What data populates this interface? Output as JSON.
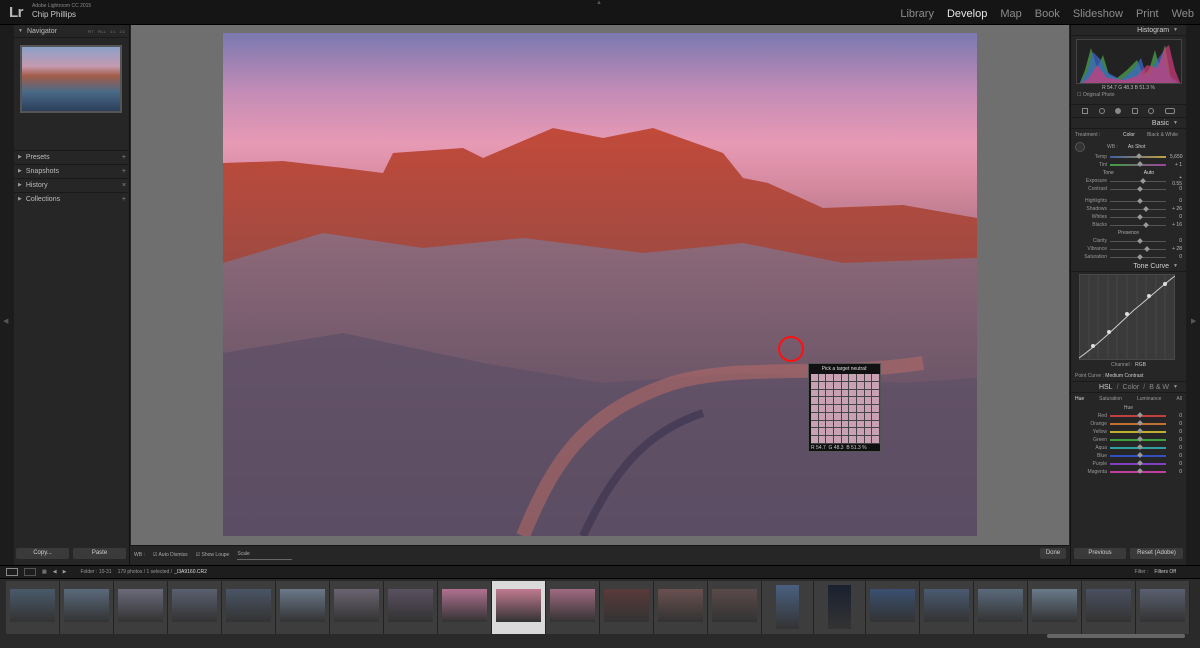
{
  "app": {
    "logo": "Lr",
    "product": "Adobe Lightroom CC 2015",
    "user": "Chip Phillips"
  },
  "modules": [
    "Library",
    "Develop",
    "Map",
    "Book",
    "Slideshow",
    "Print",
    "Web"
  ],
  "active_module": "Develop",
  "left": {
    "navigator": "Navigator",
    "zoom": [
      "FIT",
      "FILL",
      "1:1",
      "2:1"
    ],
    "sections": [
      "Presets",
      "Snapshots",
      "History",
      "Collections"
    ],
    "copy": "Copy...",
    "paste": "Paste"
  },
  "picker": {
    "title": "Pick a target neutral:",
    "r": "R  54.7",
    "g": "G  48.3",
    "b": "B  51.3  %"
  },
  "toolbar": {
    "wb": "WB :",
    "auto_dismiss": "Auto Dismiss",
    "show_loupe": "Show Loupe",
    "scale": "Scale",
    "done": "Done"
  },
  "right": {
    "histogram": "Histogram",
    "histo_vals": "R  54.7   G  48.3   B  51.3  %",
    "original": "Original Photo",
    "basic": "Basic",
    "treatment": "Treatment :",
    "color": "Color",
    "bw": "Black & White",
    "wb": "WB :",
    "wb_val": "As Shot",
    "tone": "Tone",
    "auto": "Auto",
    "presence": "Presence",
    "sliders_wb": [
      {
        "l": "Temp",
        "v": "5,650"
      },
      {
        "l": "Tint",
        "v": "+ 1"
      }
    ],
    "sliders_tone": [
      {
        "l": "Exposure",
        "v": "+ 0.55"
      },
      {
        "l": "Contrast",
        "v": "0"
      },
      {
        "l": "Highlights",
        "v": "0"
      },
      {
        "l": "Shadows",
        "v": "+ 26"
      },
      {
        "l": "Whites",
        "v": "0"
      },
      {
        "l": "Blacks",
        "v": "+ 16"
      }
    ],
    "sliders_presence": [
      {
        "l": "Clarity",
        "v": "0"
      },
      {
        "l": "Vibrance",
        "v": "+ 28"
      },
      {
        "l": "Saturation",
        "v": "0"
      }
    ],
    "tonecurve": "Tone Curve",
    "channel": "Channel :",
    "channel_val": "RGB",
    "pointcurve": "Point Curve :",
    "pointcurve_val": "Medium Contrast",
    "hsl": "HSL",
    "hsl_color": "Color",
    "hsl_bw": "B & W",
    "hsl_tabs": [
      "Hue",
      "Saturation",
      "Luminance",
      "All"
    ],
    "hue": "Hue",
    "hue_rows": [
      "Red",
      "Orange",
      "Yellow",
      "Green",
      "Aqua",
      "Blue",
      "Purple",
      "Magenta"
    ],
    "previous": "Previous",
    "reset": "Reset (Adobe)"
  },
  "film": {
    "folder": "Folder : 10-31",
    "count": "179 photos / 1 selected /",
    "file": "_I3A9160.CR2",
    "filter": "Filter :",
    "filter_val": "Filters Off"
  }
}
